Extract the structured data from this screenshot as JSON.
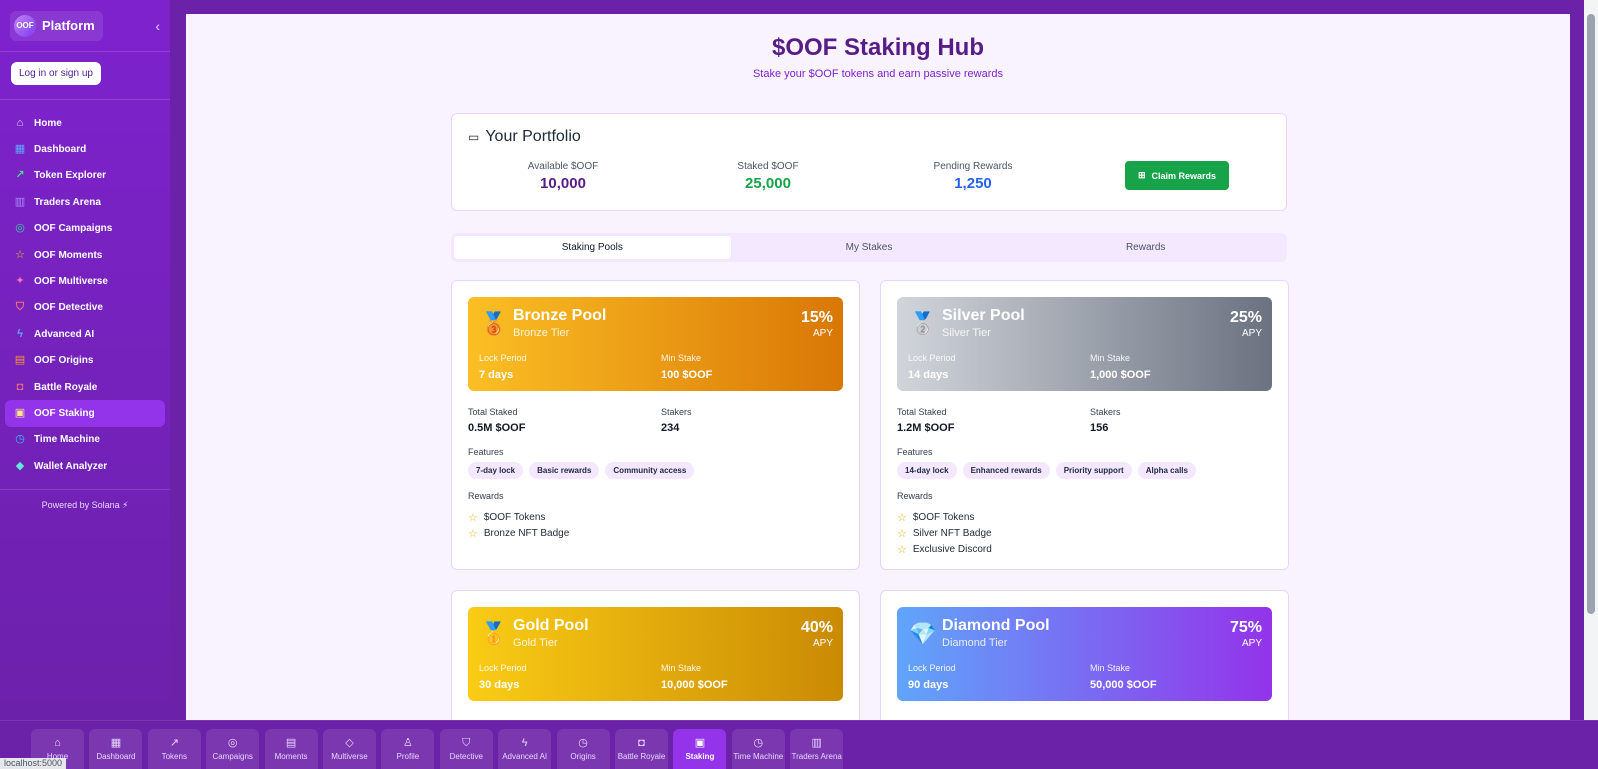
{
  "sidebar": {
    "logo_badge": "OOF",
    "logo_text": "Platform",
    "collapse_icon": "‹",
    "login_label": "Log in or sign up",
    "items": [
      {
        "label": "Home",
        "icon": "⌂",
        "color": "#e9d5ff"
      },
      {
        "label": "Dashboard",
        "icon": "▦",
        "color": "#60a5fa"
      },
      {
        "label": "Token Explorer",
        "icon": "↗",
        "color": "#4ade80"
      },
      {
        "label": "Traders Arena",
        "icon": "▥",
        "color": "#a78bfa"
      },
      {
        "label": "OOF Campaigns",
        "icon": "◎",
        "color": "#34d399"
      },
      {
        "label": "OOF Moments",
        "icon": "☆",
        "color": "#facc15"
      },
      {
        "label": "OOF Multiverse",
        "icon": "✦",
        "color": "#f472b6"
      },
      {
        "label": "OOF Detective",
        "icon": "⛉",
        "color": "#f87171"
      },
      {
        "label": "Advanced AI",
        "icon": "ϟ",
        "color": "#60a5fa"
      },
      {
        "label": "OOF Origins",
        "icon": "▤",
        "color": "#fb923c"
      },
      {
        "label": "Battle Royale",
        "icon": "◘",
        "color": "#f87171"
      },
      {
        "label": "OOF Staking",
        "icon": "▣",
        "color": "#fde68a"
      },
      {
        "label": "Time Machine",
        "icon": "◷",
        "color": "#38bdf8"
      },
      {
        "label": "Wallet Analyzer",
        "icon": "◆",
        "color": "#5eead4"
      }
    ],
    "powered": "Powered by Solana ⚡"
  },
  "hub": {
    "title": "$OOF Staking Hub",
    "subtitle": "Stake your $OOF tokens and earn passive rewards"
  },
  "portfolio": {
    "title": "Your Portfolio",
    "wallet_icon": "▭",
    "available_label": "Available $OOF",
    "available_value": "10,000",
    "staked_label": "Staked $OOF",
    "staked_value": "25,000",
    "pending_label": "Pending Rewards",
    "pending_value": "1,250",
    "claim_icon": "⊞",
    "claim_label": "Claim Rewards"
  },
  "tabs": [
    "Staking Pools",
    "My Stakes",
    "Rewards"
  ],
  "pools": [
    {
      "name": "Bronze Pool",
      "tier": "Bronze Tier",
      "emoji": "🥉",
      "apy": "15%",
      "apy_label": "APY",
      "lock_label": "Lock Period",
      "lock_value": "7 days",
      "min_label": "Min Stake",
      "min_value": "100 $OOF",
      "total_label": "Total Staked",
      "total_value": "0.5M $OOF",
      "stakers_label": "Stakers",
      "stakers_value": "234",
      "features_label": "Features",
      "features": [
        "7-day lock",
        "Basic rewards",
        "Community access"
      ],
      "rewards_label": "Rewards",
      "rewards": [
        "$OOF Tokens",
        "Bronze NFT Badge"
      ],
      "gradient": [
        "#fbbf24",
        "#d97706"
      ]
    },
    {
      "name": "Silver Pool",
      "tier": "Silver Tier",
      "emoji": "🥈",
      "apy": "25%",
      "apy_label": "APY",
      "lock_label": "Lock Period",
      "lock_value": "14 days",
      "min_label": "Min Stake",
      "min_value": "1,000 $OOF",
      "total_label": "Total Staked",
      "total_value": "1.2M $OOF",
      "stakers_label": "Stakers",
      "stakers_value": "156",
      "features_label": "Features",
      "features": [
        "14-day lock",
        "Enhanced rewards",
        "Priority support",
        "Alpha calls"
      ],
      "rewards_label": "Rewards",
      "rewards": [
        "$OOF Tokens",
        "Silver NFT Badge",
        "Exclusive Discord"
      ],
      "gradient": [
        "#d1d5db",
        "#6b7280"
      ]
    },
    {
      "name": "Gold Pool",
      "tier": "Gold Tier",
      "emoji": "🥇",
      "apy": "40%",
      "apy_label": "APY",
      "lock_label": "Lock Period",
      "lock_value": "30 days",
      "min_label": "Min Stake",
      "min_value": "10,000 $OOF",
      "gradient": [
        "#facc15",
        "#ca8a04"
      ]
    },
    {
      "name": "Diamond Pool",
      "tier": "Diamond Tier",
      "emoji": "💎",
      "apy": "75%",
      "apy_label": "APY",
      "lock_label": "Lock Period",
      "lock_value": "90 days",
      "min_label": "Min Stake",
      "min_value": "50,000 $OOF",
      "gradient": [
        "#60a5fa",
        "#9333ea"
      ]
    }
  ],
  "bottom_nav": [
    {
      "label": "Home",
      "icon": "⌂"
    },
    {
      "label": "Dashboard",
      "icon": "▦"
    },
    {
      "label": "Tokens",
      "icon": "↗"
    },
    {
      "label": "Campaigns",
      "icon": "◎"
    },
    {
      "label": "Moments",
      "icon": "▤"
    },
    {
      "label": "Multiverse",
      "icon": "◇"
    },
    {
      "label": "Profile",
      "icon": "♙"
    },
    {
      "label": "Detective",
      "icon": "⛉"
    },
    {
      "label": "Advanced AI",
      "icon": "ϟ"
    },
    {
      "label": "Origins",
      "icon": "◷"
    },
    {
      "label": "Battle Royale",
      "icon": "◘"
    },
    {
      "label": "Staking",
      "icon": "▣"
    },
    {
      "label": "Time Machine",
      "icon": "◷"
    },
    {
      "label": "Traders Arena",
      "icon": "▥"
    }
  ],
  "status": "localhost:5000"
}
